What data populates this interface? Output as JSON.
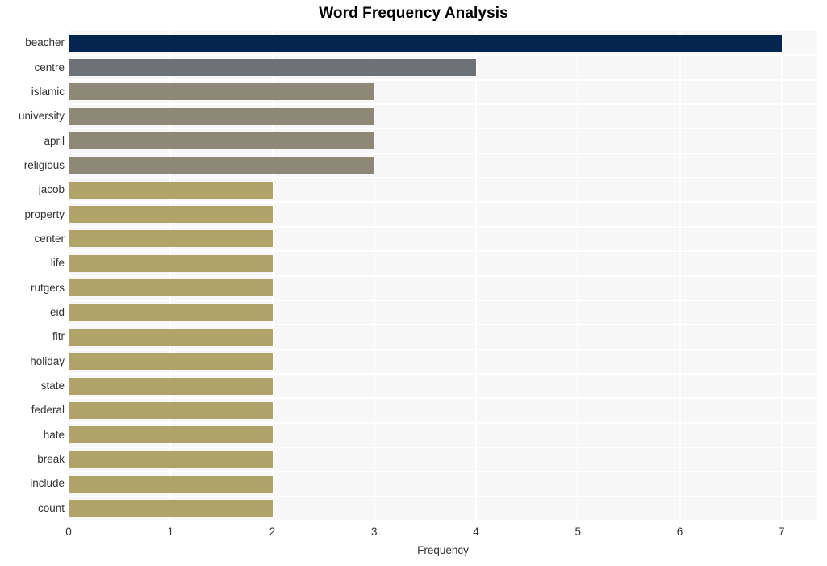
{
  "chart_data": {
    "type": "bar",
    "orientation": "horizontal",
    "title": "Word Frequency Analysis",
    "xlabel": "Frequency",
    "ylabel": "",
    "xlim": [
      0,
      7.35
    ],
    "xticks": [
      0,
      1,
      2,
      3,
      4,
      5,
      6,
      7
    ],
    "xtick_labels": [
      "0",
      "1",
      "2",
      "3",
      "4",
      "5",
      "6",
      "7"
    ],
    "grid": true,
    "legend": false,
    "categories": [
      "beacher",
      "centre",
      "islamic",
      "university",
      "april",
      "religious",
      "jacob",
      "property",
      "center",
      "life",
      "rutgers",
      "eid",
      "fitr",
      "holiday",
      "state",
      "federal",
      "hate",
      "break",
      "include",
      "count"
    ],
    "values": [
      7,
      4,
      3,
      3,
      3,
      3,
      2,
      2,
      2,
      2,
      2,
      2,
      2,
      2,
      2,
      2,
      2,
      2,
      2,
      2
    ],
    "bar_colors": [
      "#04254e",
      "#6e7176",
      "#8d8878",
      "#8d8878",
      "#8d8878",
      "#8d8878",
      "#b0a369",
      "#b0a369",
      "#b0a369",
      "#b0a369",
      "#b0a369",
      "#b0a369",
      "#b0a369",
      "#b0a369",
      "#b0a369",
      "#b0a369",
      "#b0a369",
      "#b0a369",
      "#b0a369",
      "#b0a369"
    ]
  },
  "style": {
    "plot_background": "#f7f7f7",
    "grid_color": "#ffffff",
    "page_background": "#ffffff",
    "text_color": "#333333",
    "title_color": "#000000"
  }
}
